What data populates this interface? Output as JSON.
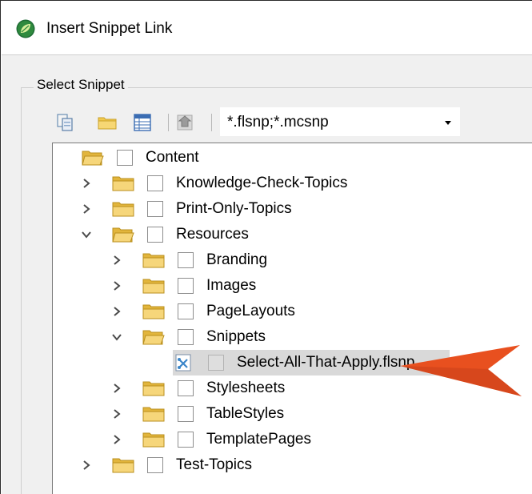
{
  "window": {
    "title": "Insert Snippet Link",
    "icon": "flare-leaf-icon"
  },
  "group": {
    "label": "Select Snippet"
  },
  "toolbar": {
    "buttons": [
      "copy-icon",
      "folder-icon",
      "grid-view-icon",
      "navigate-up-icon"
    ],
    "filter_value": "*.flsnp;*.mcsnp"
  },
  "tree": {
    "rows": [
      {
        "label": "Content",
        "expander": "none",
        "folder": "open",
        "checked": false,
        "selected": false
      },
      {
        "label": "Knowledge-Check-Topics",
        "expander": "collapsed",
        "folder": "closed",
        "checked": false,
        "selected": false
      },
      {
        "label": "Print-Only-Topics",
        "expander": "collapsed",
        "folder": "closed",
        "checked": false,
        "selected": false
      },
      {
        "label": "Resources",
        "expander": "expanded",
        "folder": "open",
        "checked": false,
        "selected": false
      },
      {
        "label": "Branding",
        "expander": "collapsed",
        "folder": "closed",
        "checked": false,
        "selected": false
      },
      {
        "label": "Images",
        "expander": "collapsed",
        "folder": "closed",
        "checked": false,
        "selected": false
      },
      {
        "label": "PageLayouts",
        "expander": "collapsed",
        "folder": "closed",
        "checked": false,
        "selected": false
      },
      {
        "label": "Snippets",
        "expander": "expanded",
        "folder": "open",
        "checked": false,
        "selected": false
      },
      {
        "label": "Select-All-That-Apply.flsnp",
        "expander": "none",
        "folder": "snippet-file",
        "checked": false,
        "selected": true
      },
      {
        "label": "Stylesheets",
        "expander": "collapsed",
        "folder": "closed",
        "checked": false,
        "selected": false
      },
      {
        "label": "TableStyles",
        "expander": "collapsed",
        "folder": "closed",
        "checked": false,
        "selected": false
      },
      {
        "label": "TemplatePages",
        "expander": "collapsed",
        "folder": "closed",
        "checked": false,
        "selected": false
      },
      {
        "label": "Test-Topics",
        "expander": "collapsed",
        "folder": "closed",
        "checked": false,
        "selected": false
      }
    ]
  },
  "callout": {
    "icon": "pointer-arrow-icon",
    "color": "#e8501f"
  },
  "colors": {
    "folder": "#f2c94c",
    "selection": "#d9d9d9",
    "app_icon": "#2e7d32"
  }
}
